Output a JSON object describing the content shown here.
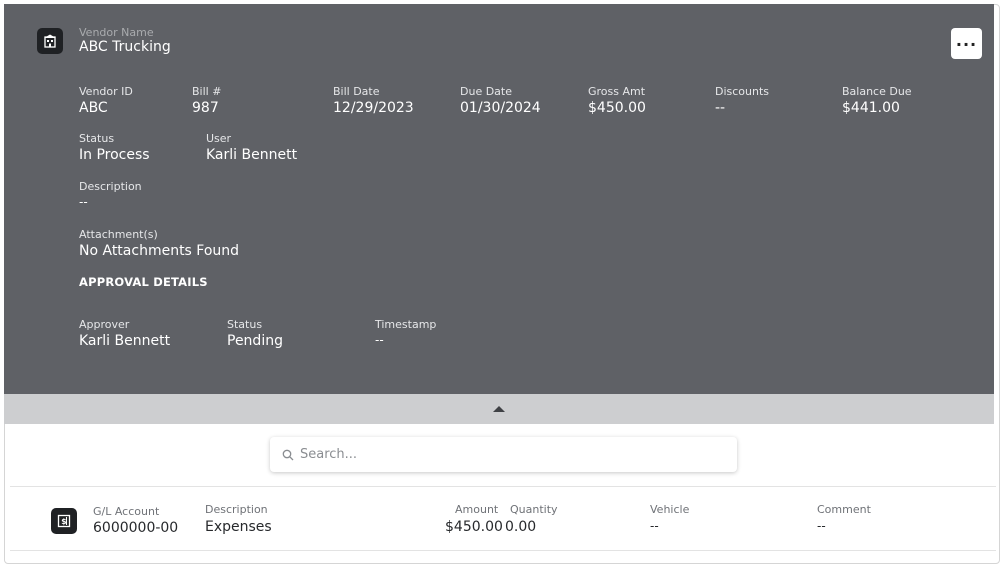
{
  "vendor": {
    "label": "Vendor Name",
    "name": "ABC Trucking"
  },
  "fields_row1": [
    {
      "label": "Vendor ID",
      "value": "ABC"
    },
    {
      "label": "Bill #",
      "value": "987"
    },
    {
      "label": "Bill Date",
      "value": "12/29/2023"
    },
    {
      "label": "Due Date",
      "value": "01/30/2024"
    },
    {
      "label": "Gross Amt",
      "value": "$450.00"
    },
    {
      "label": "Discounts",
      "value": "--"
    },
    {
      "label": "Balance Due",
      "value": "$441.00"
    }
  ],
  "status": {
    "label": "Status",
    "value": "In Process"
  },
  "user": {
    "label": "User",
    "value": "Karli Bennett"
  },
  "description": {
    "label": "Description",
    "value": "--"
  },
  "attachments": {
    "label": "Attachment(s)",
    "value": "No Attachments Found"
  },
  "approval": {
    "title": "APPROVAL DETAILS",
    "approver": {
      "label": "Approver",
      "value": "Karli Bennett"
    },
    "status": {
      "label": "Status",
      "value": "Pending"
    },
    "timestamp": {
      "label": "Timestamp",
      "value": "--"
    }
  },
  "more_button": {
    "label": "..."
  },
  "search": {
    "placeholder": "Search..."
  },
  "line_item": {
    "gl_account": {
      "label": "G/L Account",
      "value": "6000000-00"
    },
    "description": {
      "label": "Description",
      "value": "Expenses"
    },
    "amount": {
      "label": "Amount",
      "value": "$450.00"
    },
    "quantity": {
      "label": "Quantity",
      "value": "0.00"
    },
    "vehicle": {
      "label": "Vehicle",
      "value": "--"
    },
    "comment": {
      "label": "Comment",
      "value": "--"
    }
  },
  "colors": {
    "header_bg": "#5f6166",
    "collapse_bar": "#cdced0",
    "icon_bg": "#1f2124"
  }
}
